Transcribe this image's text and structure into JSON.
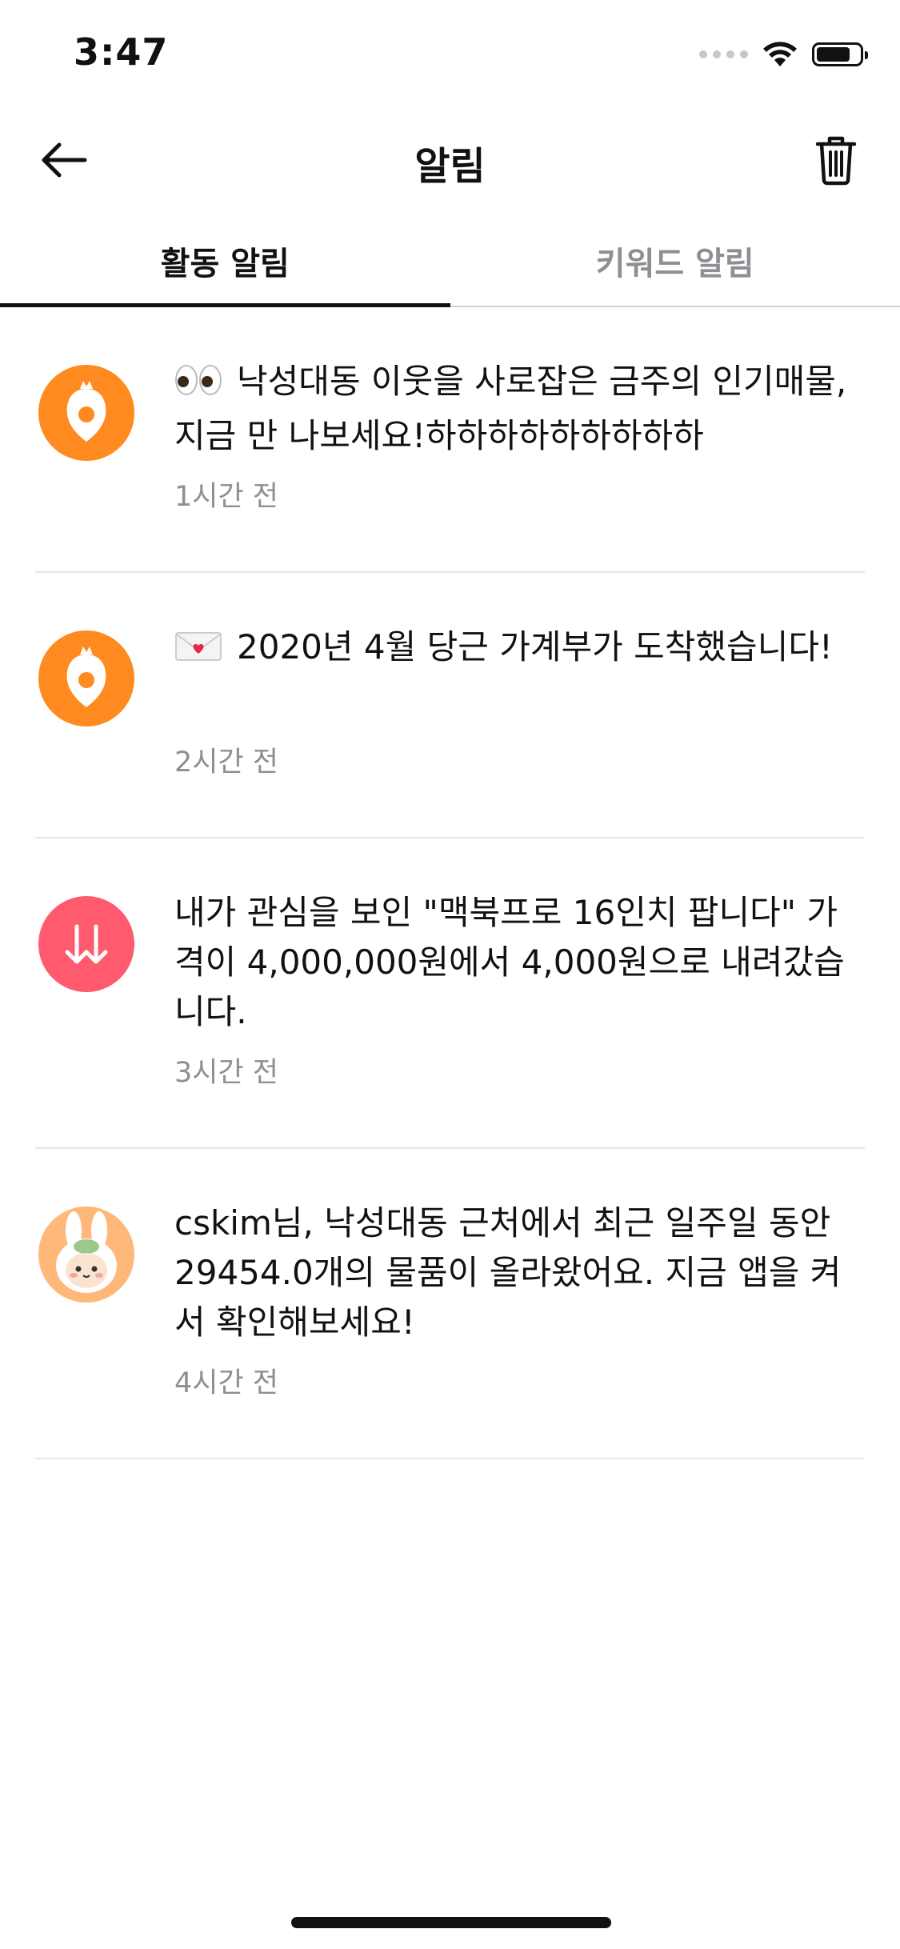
{
  "status_bar": {
    "time": "3:47"
  },
  "nav": {
    "title": "알림",
    "back_icon": "arrow-left-icon",
    "trash_icon": "trash-icon"
  },
  "tabs": [
    {
      "label": "활동 알림",
      "active": true
    },
    {
      "label": "키워드 알림",
      "active": false
    }
  ],
  "notifications": [
    {
      "icon": "carrot-logo-icon",
      "emoji": "eyes-emoji",
      "text": "낙성대동 이웃을 사로잡은 금주의 인기매물, 지금 만 나보세요!하하하하하하하하하",
      "time": "1시간 전"
    },
    {
      "icon": "carrot-logo-icon",
      "emoji": "love-letter-emoji",
      "text": "2020년 4월 당근 가계부가 도착했습니다!",
      "time": "2시간 전"
    },
    {
      "icon": "price-down-icon",
      "text": "내가 관심을 보인 \"맥북프로 16인치 팝니다\" 가격이 4,000,000원에서 4,000원으로 내려갔습니다.",
      "time": "3시간 전"
    },
    {
      "icon": "bunny-avatar-icon",
      "text": "cskim님, 낙성대동 근처에서 최근 일주일 동안 29454.0개의 물품이 올라왔어요. 지금 앱을 켜서 확인해보세요!",
      "time": "4시간 전"
    }
  ],
  "colors": {
    "brand_orange": "#ff8a1f",
    "price_red": "#ff5a6e",
    "muted_text": "#8e8e93",
    "divider": "#e6e6e6"
  }
}
